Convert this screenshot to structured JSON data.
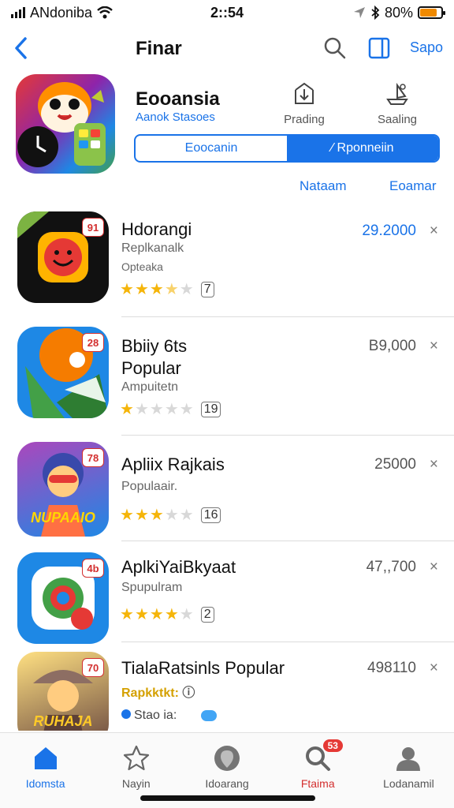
{
  "status_bar": {
    "carrier": "ANdoniba",
    "time": "2::54",
    "battery": "80%",
    "battery_level": 0.8
  },
  "nav": {
    "title": "Finar",
    "action": "Sapo"
  },
  "featured": {
    "name": "Eooansia",
    "subtitle": "Aanok Stasoes",
    "stat1_label": "Prading",
    "stat2_label": "Saaling",
    "segment_left": "Eoocanin",
    "segment_right": "⁄ Rponneiin",
    "link_left": "Nataam",
    "link_right": "Eoamar"
  },
  "apps": [
    {
      "title": "Hdorangi",
      "subtitle": "Replkanalk",
      "subtitle2": "Opteaka",
      "badge": "91",
      "rating": 3.5,
      "rating_count": "7",
      "price": "29.2000",
      "close": "×"
    },
    {
      "title": "Bbiiy 6ts",
      "title2": "Popular",
      "subtitle": "Ampuitetn",
      "badge": "28",
      "rating": 1,
      "rating_count": "19",
      "price": "B9,000",
      "close": "×"
    },
    {
      "title": "Apliix Rajkais",
      "subtitle": "Populaair.",
      "badge": "78",
      "rating": 3,
      "rating_count": "16",
      "price": "25000",
      "close": "×",
      "icon_text": "NUPAAIO"
    },
    {
      "title": "AplkiYaiBkyaat",
      "subtitle": "Spupulram",
      "badge": "4b",
      "rating": 4,
      "rating_count": "2",
      "price": "47,,700",
      "close": "×"
    },
    {
      "title": "TialaRatsinls Popular",
      "subtitle": "Rapkktkt:",
      "subtitle_suffix": "ⓘ",
      "subtitle2": "Stao ia:",
      "badge": "70",
      "price": "498110",
      "close": "×",
      "icon_text": "RUHAJA"
    }
  ],
  "tabs": [
    {
      "label": "Idomsta",
      "icon": "home-icon"
    },
    {
      "label": "Nayin",
      "icon": "star-icon"
    },
    {
      "label": "Idoarang",
      "icon": "location-icon"
    },
    {
      "label": "Ftaima",
      "icon": "search-icon",
      "badge": "53"
    },
    {
      "label": "Lodanamil",
      "icon": "person-icon"
    }
  ],
  "colors": {
    "accent": "#1a73e8",
    "star": "#f5b50a",
    "alert": "#e53935"
  }
}
